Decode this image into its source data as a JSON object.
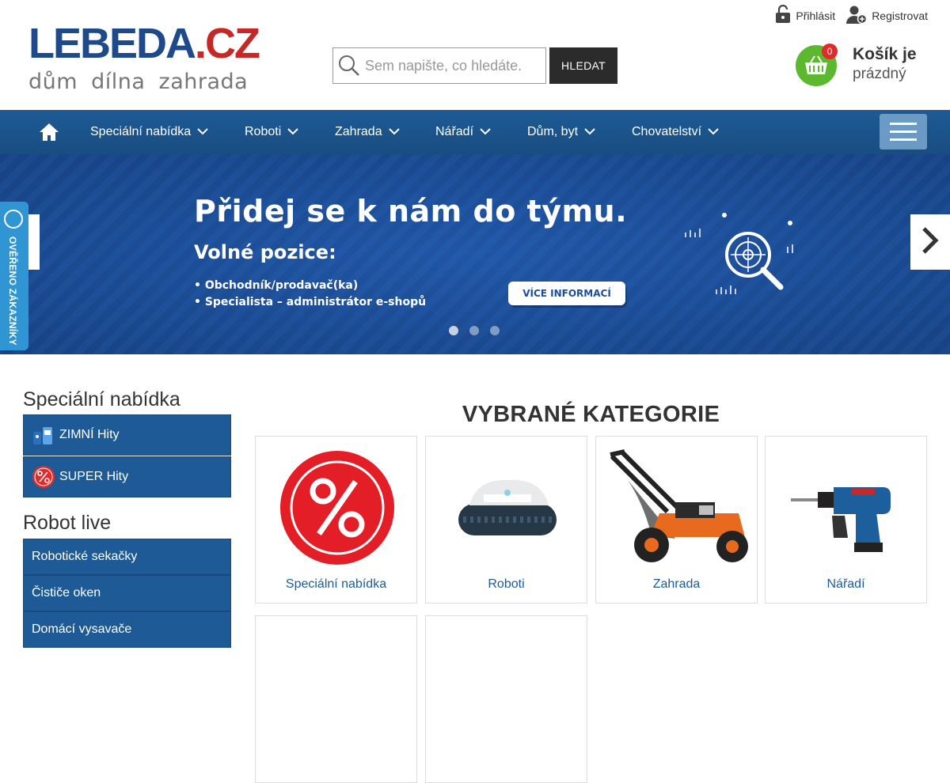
{
  "header": {
    "logo_main": "LEBEDA",
    "logo_dot": ".",
    "logo_cz": "CZ",
    "logo_tagline": "dům dílna zahrada",
    "search_placeholder": "Sem napište, co hledáte.",
    "search_button": "HLEDAT",
    "login": "Přihlásit",
    "register": "Registrovat",
    "cart_count": "0",
    "cart_title": "Košík je",
    "cart_sub": "prázdný"
  },
  "nav": {
    "items": [
      {
        "label": "Speciální nabídka"
      },
      {
        "label": "Roboti"
      },
      {
        "label": "Zahrada"
      },
      {
        "label": "Nářadí"
      },
      {
        "label": "Dům, byt"
      },
      {
        "label": "Chovatelství"
      }
    ]
  },
  "banner": {
    "title": "Přidej se k nám do týmu.",
    "subtitle": "Volné pozice:",
    "positions": [
      "• Obchodník/prodavač(ka)",
      "• Specialista – administrátor e-shopů"
    ],
    "cta": "VÍCE INFORMACÍ",
    "slides": 3,
    "active_slide": 1
  },
  "verified": {
    "label": "OVĚŘENO ZÁKAZNÍKY"
  },
  "sidebar": {
    "sections": [
      {
        "heading": "Speciální nabídka",
        "items": [
          "ZIMNÍ Hity",
          "SUPER Hity"
        ]
      },
      {
        "heading": "Robot live",
        "items": [
          "Robotické sekačky",
          "Čističe oken",
          "Domácí vysavače"
        ]
      }
    ]
  },
  "categories": {
    "heading": "VYBRANÉ KATEGORIE",
    "items": [
      {
        "label": "Speciální nabídka",
        "icon": "percent-icon"
      },
      {
        "label": "Roboti",
        "icon": "pool-robot-icon"
      },
      {
        "label": "Zahrada",
        "icon": "lawn-mower-icon"
      },
      {
        "label": "Nářadí",
        "icon": "drill-icon"
      }
    ]
  },
  "colors": {
    "brand_blue": "#1e5b96",
    "cart_green": "#5cb82e",
    "badge_red": "#e02b2b",
    "verified_blue": "#2f95d3"
  }
}
